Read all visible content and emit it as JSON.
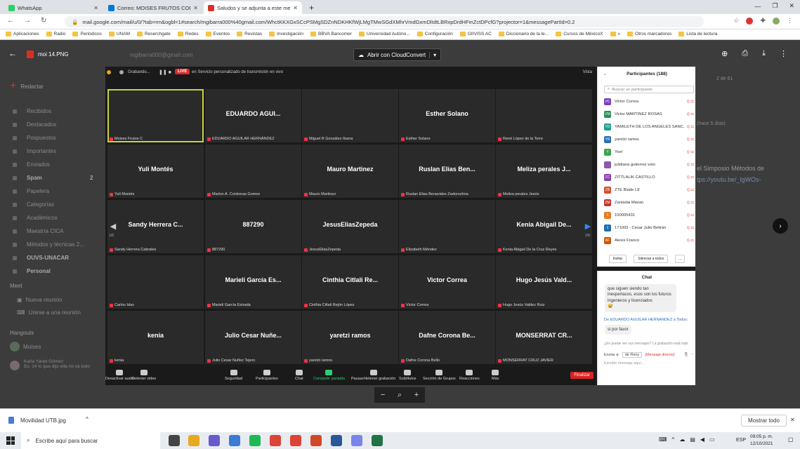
{
  "browser": {
    "tabs": [
      {
        "label": "WhatsApp",
        "color": "#25d366"
      },
      {
        "label": "Correo: MOISES FRUTOS CORTE:",
        "color": "#0078d4"
      },
      {
        "label": "Saludos y se adjunta a este men:",
        "color": "#d93025",
        "active": true
      }
    ],
    "new_tab": "+",
    "url": "mail.google.com/mail/u/0/?tab=rm&ogbl=1#search/mgibarra000%40gmail.com/WhctKKXGxSCcPSMgSDZnNDKHKfWjLMgTMwSGdXMhrVmdGxmDlIdtLBRxpDrdHFmZctDPcfG?projector=1&messagePartId=0.2",
    "bookmarks": [
      "Aplicaciones",
      "Radio",
      "Periódicos",
      "UNAM",
      "Reserchgate",
      "Redes",
      "Eventos",
      "Revistas",
      "Investigación",
      "BBVA Bancomer",
      "Universidad Autóno...",
      "Configuración",
      "GIIVISS AC",
      "Diccionario de la le...",
      "Cursos de MéxicoX",
      "»",
      "Otros marcadores",
      "Lista de lectura"
    ]
  },
  "gmail": {
    "compose": "Redactar",
    "items": [
      "Recibidos",
      "Destacados",
      "Pospuestos",
      "Importantes",
      "Enviados",
      "Spam",
      "Papelera",
      "Categorías",
      "Académicos",
      "Maestría CICA",
      "Métodos y técnicas 2...",
      "OUVS-UNACAR",
      "Personal"
    ],
    "spam_count": "2",
    "meet": "Meet",
    "meet_items": [
      "Nueva reunión",
      "Unirse a una reunión"
    ],
    "hangouts": "Hangouts",
    "hangouts_user": "Moises",
    "contact_name": "Karla Yanet Gómez",
    "contact_msg": "Es: 14 lo que dijo ella no va todo",
    "search_text": "mgibarra000@gmail.com",
    "right_snippets": [
      "2 de 61",
      "(hace 5 días)",
      "el Simposio Métodos de",
      "tps://youtu.be/_lgWOs-"
    ]
  },
  "viewer": {
    "filename": "moi 14.PNG",
    "open_with": "Abrir con CloudConvert"
  },
  "zoom": {
    "top": {
      "recording": "Grabando...",
      "live": "LIVE",
      "stream": "en Servicio personalizado de transmisión en vivo",
      "view": "Vista"
    },
    "tiles": [
      {
        "name": "",
        "label": "Moises Frutos C",
        "cam": "man-glasses",
        "hl": true
      },
      {
        "name": "EDUARDO AGUI...",
        "label": "EDUARDO AGUILAR HERNÁNDEZ"
      },
      {
        "name": "",
        "label": "Miguel R González Ibarra",
        "cam": "man-blue"
      },
      {
        "name": "Esther Solano",
        "label": "Esther Solano"
      },
      {
        "name": "",
        "label": "René López de la Torre",
        "cam": "man-green"
      },
      {
        "name": "Yuli Montés",
        "label": "Yuli Montés"
      },
      {
        "name": "",
        "label": "Marlon A. Contreras Gomez",
        "cam": "logo"
      },
      {
        "name": "Mauro Martinez",
        "label": "Mauro Martinez"
      },
      {
        "name": "Ruslan Elias Ben...",
        "label": "Ruslan Elias Benavides Zadorozhna"
      },
      {
        "name": "Meliza perales J...",
        "label": "Meliza perales Jesús"
      },
      {
        "name": "Sandy Herrera C...",
        "label": "Sandy Herrera Cabrales"
      },
      {
        "name": "887290",
        "label": "887290"
      },
      {
        "name": "JesusEliasZepeda",
        "label": "JesusEliasZepeda"
      },
      {
        "name": "",
        "label": "Elizabeth Méndez",
        "cam": "woman"
      },
      {
        "name": "Kenia Abigail De...",
        "label": "Kenia Abigail De la Cruz Reyes"
      },
      {
        "name": "",
        "label": "Carlos Idas",
        "cam": "young"
      },
      {
        "name": "Marieli García Es...",
        "label": "Marieli García Estrada"
      },
      {
        "name": "Cinthia Citlali Re...",
        "label": "Cinthia Citlali Rejón López"
      },
      {
        "name": "Victor Correa",
        "label": "Victor Correa"
      },
      {
        "name": "Hugo Jesús Vald...",
        "label": "Hugo Jesús Valdez Ruiz"
      },
      {
        "name": "kenia",
        "label": "kenia"
      },
      {
        "name": "Julio Cesar Nuñe...",
        "label": "Julio Cesar Nuñez Tejero"
      },
      {
        "name": "yaretzi ramos",
        "label": "yaretzi ramos"
      },
      {
        "name": "Dafne Corona Be...",
        "label": "Dafne Corona Bello"
      },
      {
        "name": "MONSERRAT CR...",
        "label": "MONSERRAT CRUZ JAVIER"
      }
    ],
    "page_left": "1/8",
    "page_right": "1/8",
    "toolbar": [
      "Desactivar audio",
      "Detener video",
      "Seguridad",
      "Participantes",
      "Chat",
      "Compartir pantalla",
      "Pausar/detener grabación",
      "Subtítulos",
      "Sección de Grupos",
      "Reacciones",
      "Más"
    ],
    "participant_count": "189",
    "end": "Finalizar"
  },
  "participants": {
    "title": "Participantes (188)",
    "search_placeholder": "Buscar un participante",
    "list": [
      {
        "ini": "VC",
        "name": "Victor Correa",
        "c": "#7b3fbf"
      },
      {
        "ini": "VM",
        "name": "Victor MARTINEZ ROSAS",
        "c": "#2e8b57"
      },
      {
        "ini": "YD",
        "name": "YAMILETH DE LOS ANGELES SANC...",
        "c": "#1f9e8f"
      },
      {
        "ini": "YR",
        "name": "yaretzi ramos",
        "c": "#2a6fb5"
      },
      {
        "ini": "Y",
        "name": "Yoel",
        "c": "#3ea34a"
      },
      {
        "ini": "",
        "name": "julidiana gutierrez soto",
        "c": "#8c5aa8"
      },
      {
        "ini": "ZC",
        "name": "ZITTLALIK CASTILLO",
        "c": "#8a3fb0"
      },
      {
        "ini": "ZB",
        "name": "ZTE Blade L8",
        "c": "#d94a2b"
      },
      {
        "ini": "ZM",
        "name": "Zaniadai Mazan",
        "c": "#c0392b"
      },
      {
        "ini": "1",
        "name": "100005431",
        "c": "#e67e22"
      },
      {
        "ini": "1",
        "name": "171003 - Cesar Julio Beltrán",
        "c": "#1f6fb5"
      },
      {
        "ini": "AF",
        "name": "Alexis Franco",
        "c": "#d35400"
      }
    ],
    "mute_all": "Invitar",
    "mute_btn": "Silenciar a todos",
    "more": "..."
  },
  "chat": {
    "title": "Chat",
    "msg1": "que siguen siendo tan inespertacos, esos son los futuros ingenieros y licenciados",
    "emoji": "😅",
    "from": "De EDUARDO AGUILAR HERNANDEZ a Todos:",
    "msg2": "si por favor",
    "notice": "¿En puede ver sus mensajes? La grabación está habi",
    "send_to": "Enviar a:",
    "to": "de Reny",
    "direct": "(Mensaje directo)",
    "placeholder": "Escribir mensaje aquí..."
  },
  "download": {
    "file": "Movilidad UTB.jpg",
    "show_all": "Mostrar todo"
  },
  "taskbar": {
    "search": "Escribe aquí para buscar",
    "lang": "ESP",
    "time": "09:05 p. m.",
    "date": "12/10/2021"
  }
}
